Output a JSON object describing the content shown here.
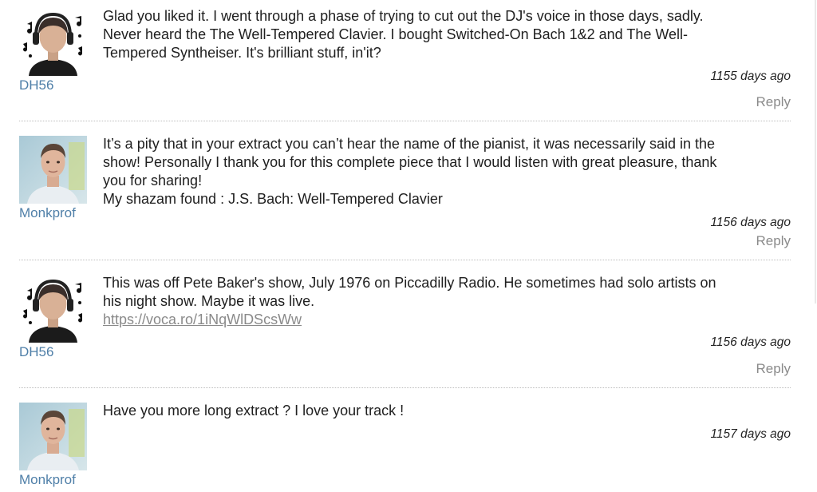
{
  "comments": [
    {
      "username": "DH56",
      "avatar": "headphones-cartoon-avatar",
      "lines": [
        "Glad you liked it.  I went through a phase of trying to cut out the DJ's voice in those days, sadly.",
        "Never heard the The Well-Tempered Clavier.  I bought Switched-On Bach 1&2 and The Well-",
        "Tempered Syntheiser.  It's brilliant stuff, in'it?"
      ],
      "timestamp": "1155 days ago",
      "reply": "Reply"
    },
    {
      "username": "Monkprof",
      "avatar": "photo-avatar",
      "lines": [
        "It’s a pity that in your extract you can’t hear the name of the pianist, it was necessarily said in the",
        "show! Personally I thank you for this complete piece that I would listen with great pleasure, thank",
        "you for sharing!",
        "My shazam found : J.S. Bach: Well-Tempered Clavier"
      ],
      "timestamp": "1156 days ago",
      "reply": "Reply"
    },
    {
      "username": "DH56",
      "avatar": "headphones-cartoon-avatar",
      "lines": [
        "This was off Pete Baker's show, July 1976 on Piccadilly Radio.  He sometimes had solo artists on",
        "his night show.  Maybe it was live."
      ],
      "link": "https://voca.ro/1iNqWlDScsWw",
      "timestamp": "1156 days ago",
      "reply": "Reply"
    },
    {
      "username": "Monkprof",
      "avatar": "photo-avatar",
      "lines": [
        "Have you more long extract ? I love your track !"
      ],
      "timestamp": "1157 days ago"
    }
  ]
}
